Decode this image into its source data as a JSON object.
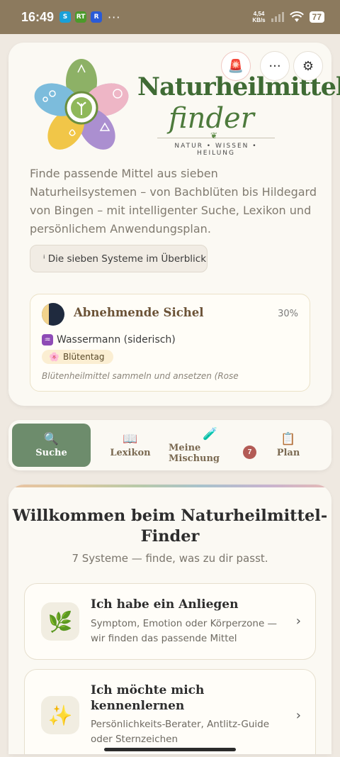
{
  "status_bar": {
    "time": "16:49",
    "app_icons": [
      "S",
      "RT",
      "R"
    ],
    "overflow": "···",
    "net_speed": "4,54",
    "net_unit": "KB/s",
    "battery": "77"
  },
  "header": {
    "alarm_icon": "🚨",
    "more_icon": "···",
    "settings_icon": "⚙",
    "brand_title": "Naturheilmittel",
    "brand_subtitle": "finder",
    "brand_tagline": "NATUR • WISSEN • HEILUNG",
    "intro": "Finde passende Mittel aus sieben Naturheilsystemen – von Bachblüten bis Hildegard von Bingen – mit intelligenter Suche, Lexikon und persönlichem Anwendungsplan.",
    "systems_button": "ⁱ Die sieben Systeme im Überblick"
  },
  "moon": {
    "phase": "Abnehmende Sichel",
    "percent": "30%",
    "zodiac_symbol": "♒",
    "zodiac": "Wassermann (siderisch)",
    "day_icon": "🌸",
    "day_type": "Blütentag",
    "note": "Blütenheilmittel sammeln und ansetzen (Rose"
  },
  "tabs": [
    {
      "icon": "🔍",
      "label": "Suche"
    },
    {
      "icon": "📖",
      "label": "Lexikon"
    },
    {
      "icon": "🧪",
      "label": "Meine Mischung",
      "badge": "7"
    },
    {
      "icon": "📋",
      "label": "Plan"
    }
  ],
  "welcome": {
    "title": "Willkommen beim Naturheilmittel-Finder",
    "subtitle": "7 Systeme — finde, was zu dir passt.",
    "options": [
      {
        "icon": "🌿",
        "title": "Ich habe ein Anliegen",
        "desc": "Symptom, Emotion oder Körperzone — wir finden das passende Mittel"
      },
      {
        "icon": "✨",
        "title": "Ich möchte mich kennenlernen",
        "desc": "Persönlichkeits-Berater, Antlitz-Guide oder Sternzeichen"
      }
    ]
  },
  "colors": {
    "status_bar": "#8c7a5e",
    "active_tab": "#6d8c6c",
    "brand_green": "#3f6b34",
    "badge": "#b35b55"
  }
}
